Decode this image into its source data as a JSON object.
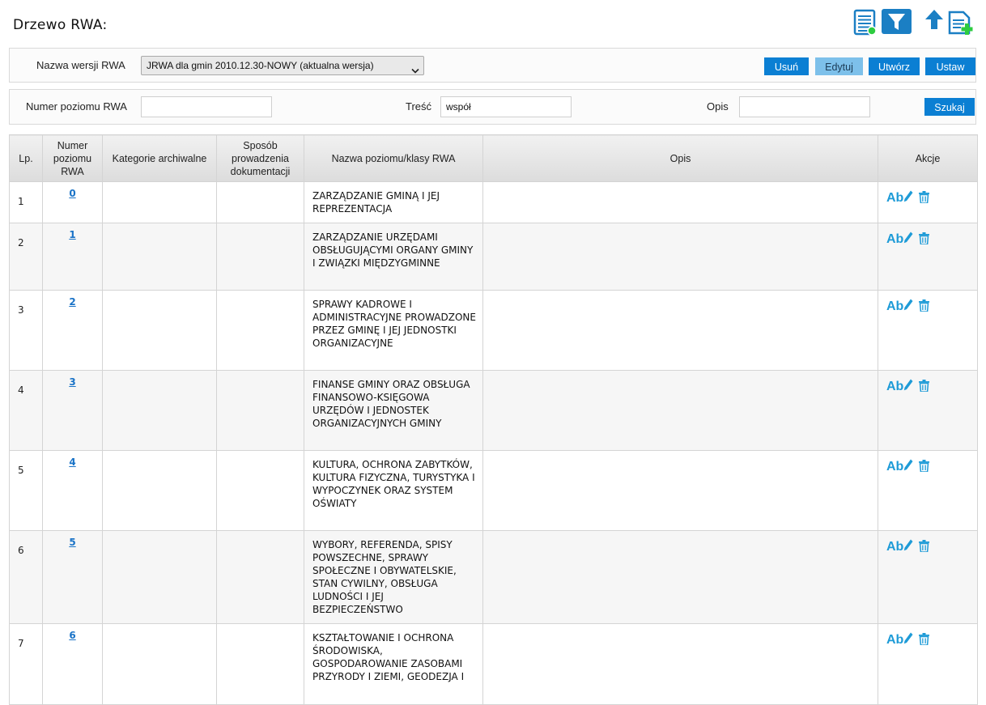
{
  "page": {
    "title": "Drzewo RWA:"
  },
  "toolbar": {
    "icons": [
      "list-icon",
      "filter-icon",
      "arrow-up-icon",
      "add-document-icon"
    ]
  },
  "version_panel": {
    "label": "Nazwa wersji RWA",
    "selected": "JRWA dla gmin 2010.12.30-NOWY (aktualna wersja)",
    "buttons": {
      "delete": "Usuń",
      "edit": "Edytuj",
      "create": "Utwórz",
      "set": "Ustaw"
    }
  },
  "search_panel": {
    "number_label": "Numer poziomu RWA",
    "number_value": "",
    "content_label": "Treść",
    "content_value": "współ",
    "desc_label": "Opis",
    "desc_value": "",
    "search_button": "Szukaj"
  },
  "table": {
    "headers": {
      "lp": "Lp.",
      "number": "Numer poziomu RWA",
      "category": "Kategorie archiwalne",
      "method": "Sposób prowadzenia dokumentacji",
      "name": "Nazwa poziomu/klasy RWA",
      "desc": "Opis",
      "actions": "Akcje"
    },
    "action_label": "Ab",
    "rows": [
      {
        "lp": "1",
        "number": "0",
        "category": "",
        "method": "",
        "name": "ZARZĄDZANIE GMINĄ I JEJ REPREZENTACJA",
        "desc": ""
      },
      {
        "lp": "2",
        "number": "1",
        "category": "",
        "method": "",
        "name": "ZARZĄDZANIE URZĘDAMI OBSŁUGUJĄCYMI ORGANY GMINY I ZWIĄZKI MIĘDZYGMINNE",
        "desc": ""
      },
      {
        "lp": "3",
        "number": "2",
        "category": "",
        "method": "",
        "name": "SPRAWY KADROWE I ADMINISTRACYJNE PROWADZONE PRZEZ GMINĘ I JEJ JEDNOSTKI ORGANIZACYJNE",
        "desc": ""
      },
      {
        "lp": "4",
        "number": "3",
        "category": "",
        "method": "",
        "name": "FINANSE GMINY ORAZ OBSŁUGA FINANSOWO-KSIĘGOWA URZĘDÓW I JEDNOSTEK ORGANIZACYJNYCH GMINY",
        "desc": ""
      },
      {
        "lp": "5",
        "number": "4",
        "category": "",
        "method": "",
        "name": "KULTURA, OCHRONA ZABYTKÓW, KULTURA FIZYCZNA, TURYSTYKA I WYPOCZYNEK ORAZ SYSTEM OŚWIATY",
        "desc": ""
      },
      {
        "lp": "6",
        "number": "5",
        "category": "",
        "method": "",
        "name": "WYBORY, REFERENDA, SPISY POWSZECHNE, SPRAWY SPOŁECZNE I OBYWATELSKIE, STAN CYWILNY, OBSŁUGA LUDNOŚCI I JEJ BEZPIECZEŃSTWO",
        "desc": ""
      },
      {
        "lp": "7",
        "number": "6",
        "category": "",
        "method": "",
        "name": "KSZTAŁTOWANIE I OCHRONA ŚRODOWISKA, GOSPODAROWANIE ZASOBAMI PRZYRODY I ZIEMI, GEODEZJA I",
        "desc": ""
      }
    ]
  }
}
